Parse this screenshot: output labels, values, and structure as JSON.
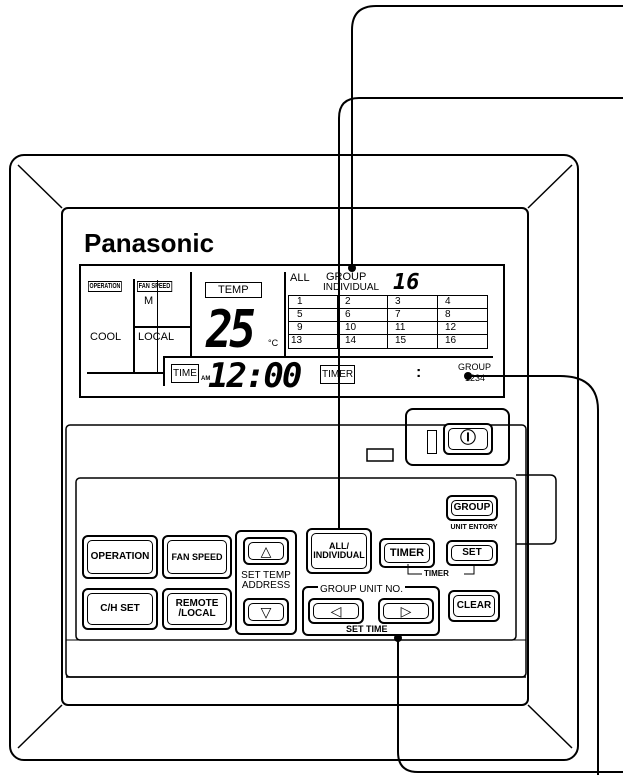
{
  "brand": "Panasonic",
  "lcd": {
    "operation_label": "OPERATION",
    "fan_speed_label": "FAN SPEED",
    "fan_speed_value": "M",
    "mode_value": "COOL",
    "control_value": "LOCAL",
    "temp_label": "TEMP",
    "temp_value": "25",
    "temp_unit": "°C",
    "all_label": "ALL",
    "group_label": "GROUP",
    "individual_label": "INDIVIDUAL",
    "group_number": "16",
    "unit_grid": [
      [
        "1",
        "2",
        "3",
        "4"
      ],
      [
        "5",
        "6",
        "7",
        "8"
      ],
      [
        "9",
        "10",
        "11",
        "12"
      ],
      [
        "13",
        "14",
        "15",
        "16"
      ]
    ],
    "time_label": "TIME",
    "am_label": "AM",
    "clock_value": "12:00",
    "timer_label": "TIMER",
    "colon_indicator": ":",
    "group_code_label": "GROUP",
    "group_code_value": "1234"
  },
  "buttons": {
    "operation": "OPERATION",
    "fan_speed": "FAN SPEED",
    "temp_up": "△",
    "temp_down": "▽",
    "set_temp_address_line1": "SET TEMP",
    "set_temp_address_line2": "ADDRESS",
    "all_individual_line1": "ALL/",
    "all_individual_line2": "INDIVIDUAL",
    "timer": "TIMER",
    "group": "GROUP",
    "unit_entory": "UNIT ENTORY",
    "set": "SET",
    "timer_bracket": "TIMER",
    "ch_set": "C/H SET",
    "remote_line1": "REMOTE",
    "remote_line2": "/LOCAL",
    "group_unit_no": "GROUP UNIT NO.",
    "left_arrow": "◁",
    "right_arrow": "▷",
    "set_time": "SET TIME",
    "clear": "CLEAR",
    "power": "Ⓘ"
  }
}
